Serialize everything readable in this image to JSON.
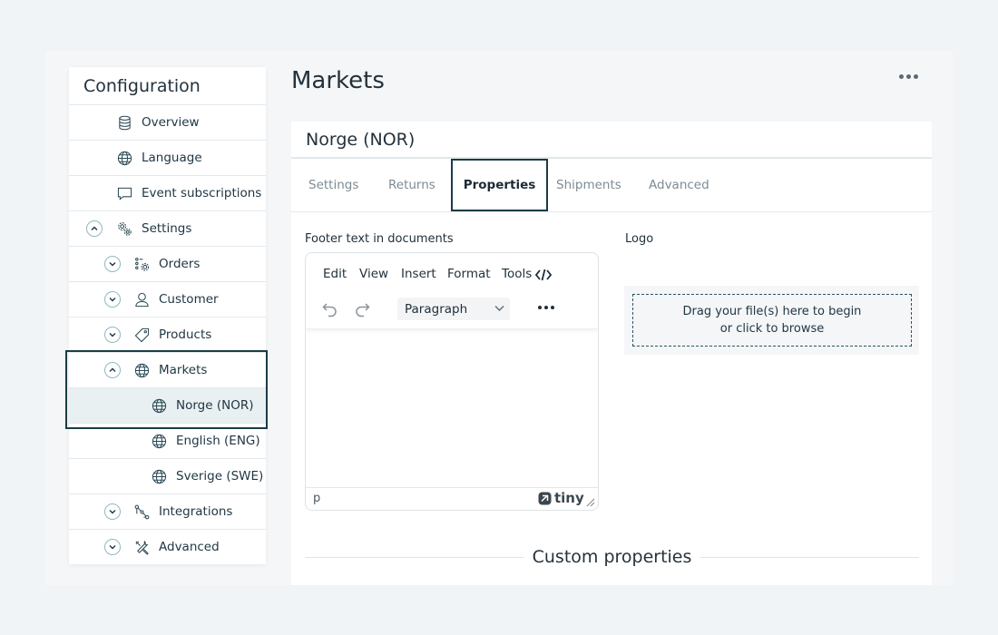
{
  "sidebar": {
    "title": "Configuration",
    "items": [
      {
        "label": "Overview",
        "icon": "database-icon"
      },
      {
        "label": "Language",
        "icon": "globe-icon"
      },
      {
        "label": "Event subscriptions",
        "icon": "chat-bubble-icon"
      },
      {
        "label": "Settings",
        "icon": "gears-icon",
        "expanded": true
      },
      {
        "label": "Orders",
        "icon": "list-gear-icon",
        "expanded": false
      },
      {
        "label": "Customer",
        "icon": "user-icon",
        "expanded": false
      },
      {
        "label": "Products",
        "icon": "tag-icon",
        "expanded": false
      },
      {
        "label": "Markets",
        "icon": "globe-icon",
        "expanded": true
      },
      {
        "label": "Norge (NOR)",
        "icon": "globe-icon",
        "active": true
      },
      {
        "label": "English (ENG)",
        "icon": "globe-icon"
      },
      {
        "label": "Sverige (SWE)",
        "icon": "globe-icon"
      },
      {
        "label": "Integrations",
        "icon": "nodes-icon",
        "expanded": false
      },
      {
        "label": "Advanced",
        "icon": "tools-icon",
        "expanded": false
      }
    ]
  },
  "page": {
    "title": "Markets"
  },
  "card": {
    "title": "Norge (NOR)",
    "tabs": [
      {
        "label": "Settings"
      },
      {
        "label": "Returns"
      },
      {
        "label": "Properties",
        "selected": true
      },
      {
        "label": "Shipments"
      },
      {
        "label": "Advanced"
      }
    ]
  },
  "footer_field": {
    "label": "Footer text in documents",
    "menu": [
      "Edit",
      "View",
      "Insert",
      "Format",
      "Tools"
    ],
    "block_format": "Paragraph",
    "status_path": "p",
    "brand": "tiny"
  },
  "logo_field": {
    "label": "Logo",
    "drop_line1": "Drag your file(s) here to begin",
    "drop_line2": "or click to browse"
  },
  "custom_properties": {
    "heading": "Custom properties"
  },
  "colors": {
    "accent": "#1b3c45",
    "chevron_border": "#8fb8bd",
    "active_bg": "#e9f0f2"
  }
}
